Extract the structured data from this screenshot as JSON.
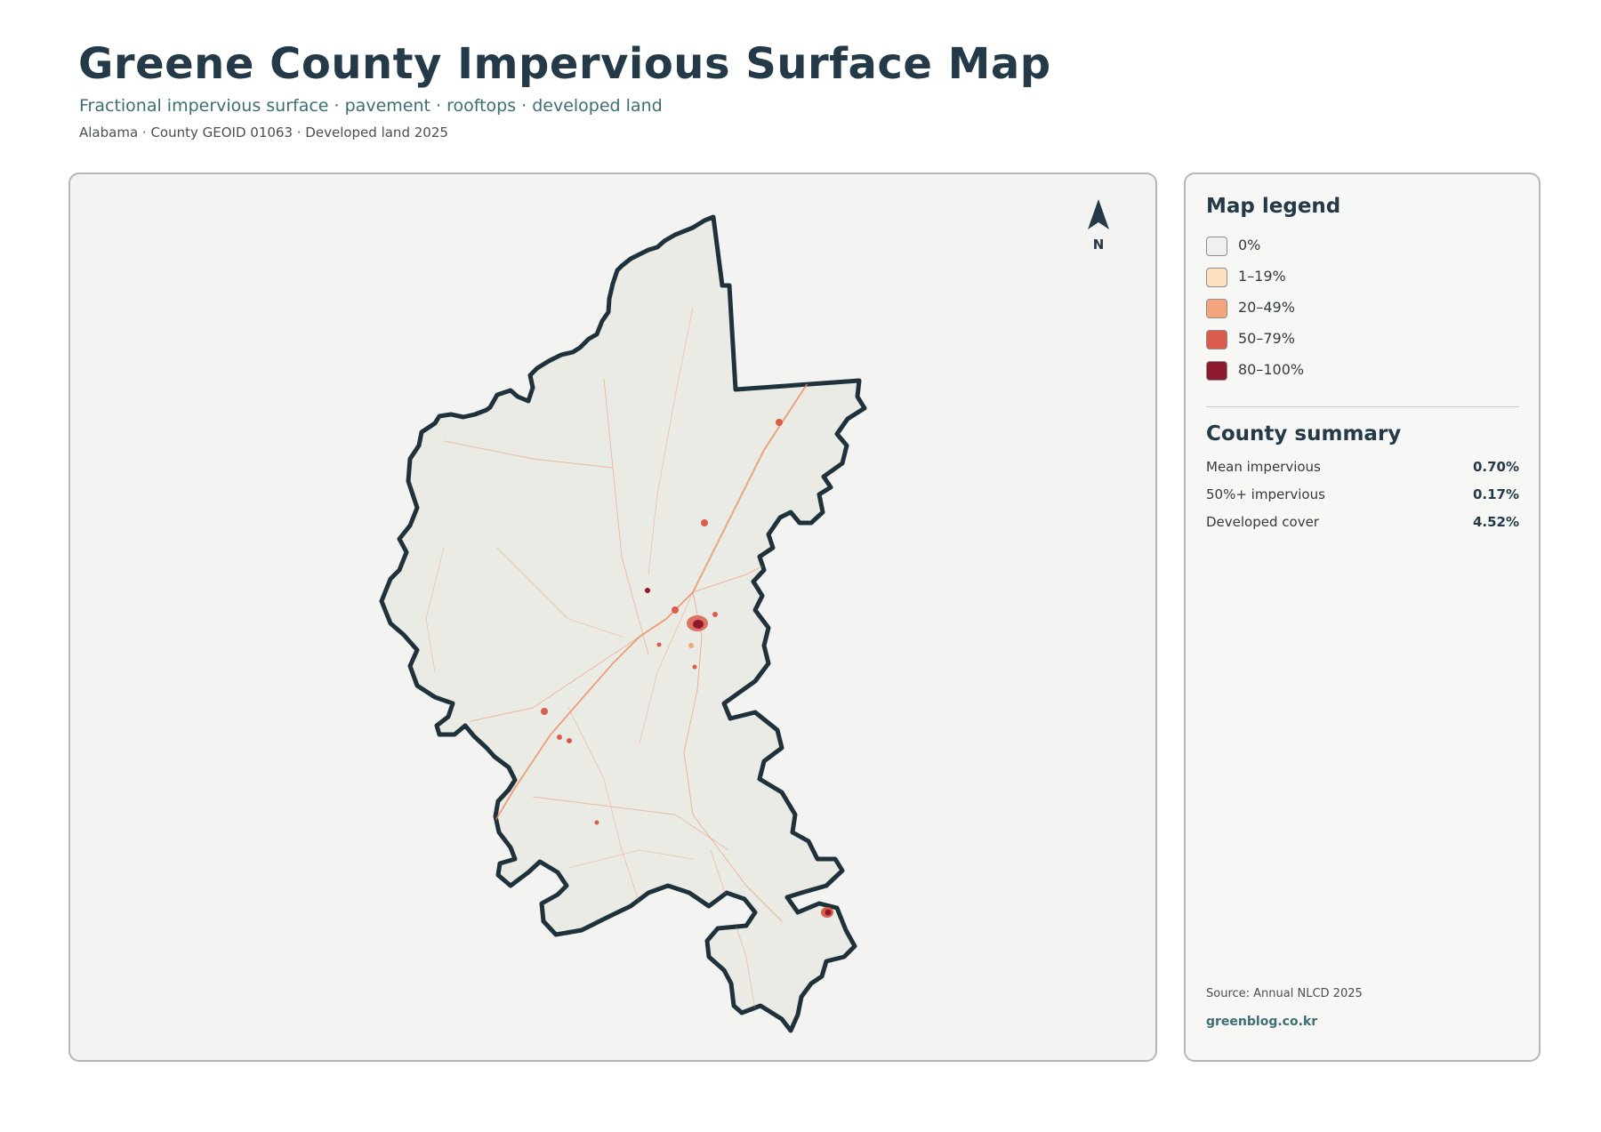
{
  "header": {
    "title": "Greene County Impervious Surface Map",
    "subtitle": "Fractional impervious surface · pavement · rooftops · developed land",
    "meta": "Alabama · County GEOID 01063 · Developed land 2025"
  },
  "map": {
    "north_label": "N",
    "county_fill": "#eaebe4",
    "boundary_color": "#1f323c",
    "road_color": "#ee8a5f",
    "urban_color": "#8c1a2c"
  },
  "legend": {
    "title": "Map legend",
    "items": [
      {
        "label": "0%",
        "color": "#f0f0ee"
      },
      {
        "label": "1–19%",
        "color": "#fde0bd"
      },
      {
        "label": "20–49%",
        "color": "#f4a57c"
      },
      {
        "label": "50–79%",
        "color": "#dc5c4b"
      },
      {
        "label": "80–100%",
        "color": "#8c1a2c"
      }
    ]
  },
  "summary": {
    "title": "County summary",
    "rows": [
      {
        "label": "Mean impervious",
        "value": "0.70%"
      },
      {
        "label": "50%+ impervious",
        "value": "0.17%"
      },
      {
        "label": "Developed cover",
        "value": "4.52%"
      }
    ]
  },
  "footer": {
    "source": "Source: Annual NLCD 2025",
    "site": "greenblog.co.kr"
  }
}
